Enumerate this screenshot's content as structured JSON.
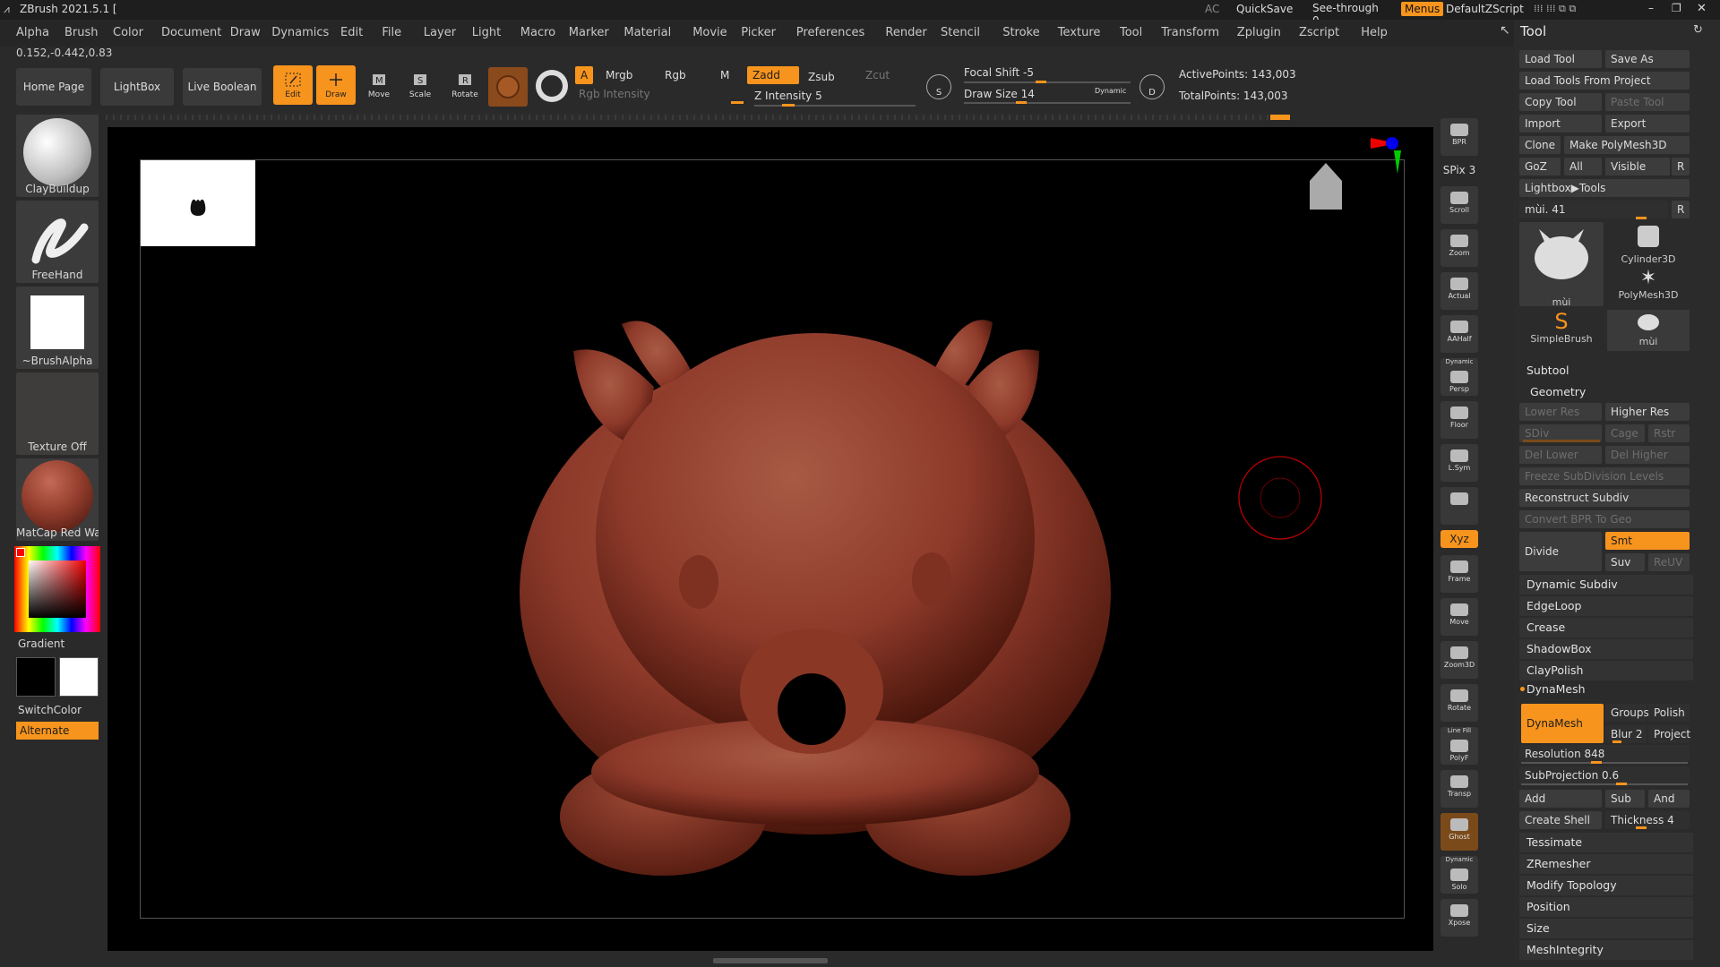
{
  "titlebar": {
    "title": "ZBrush 2021.5.1 [",
    "ac": "AC",
    "quicksave": "QuickSave",
    "seethrough": "See-through",
    "seethrough_value": "0",
    "menus": "Menus",
    "script": "DefaultZScript"
  },
  "menu": [
    "Alpha",
    "Brush",
    "Color",
    "Document",
    "Draw",
    "Dynamics",
    "Edit",
    "File",
    "Layer",
    "Light",
    "Macro",
    "Marker",
    "Material",
    "Movie",
    "Picker",
    "Preferences",
    "Render",
    "Stencil",
    "Stroke",
    "Texture",
    "Tool",
    "Transform",
    "Zplugin",
    "Zscript",
    "Help"
  ],
  "coords": "0.152,-0.442,0.83",
  "toolbar": {
    "home": "Home Page",
    "lightbox": "LightBox",
    "live_boolean": "Live Boolean",
    "edit": "Edit",
    "draw": "Draw",
    "move": "Move",
    "scale": "Scale",
    "rotate": "Rotate",
    "a": "A",
    "mrgb": "Mrgb",
    "rgb": "Rgb",
    "m": "M",
    "zadd": "Zadd",
    "zsub": "Zsub",
    "zcut": "Zcut",
    "rgb_intensity": "Rgb Intensity",
    "z_intensity": "Z Intensity 5",
    "focal_shift": "Focal Shift -5",
    "draw_size": "Draw Size 14",
    "dynamic": "Dynamic",
    "active_points": "ActivePoints: 143,003",
    "total_points": "TotalPoints: 143,003",
    "z_intensity_level": 0.05,
    "focal_level": 0.47,
    "draw_size_level": 0.14
  },
  "left": {
    "brush": "ClayBuildup",
    "stroke": "FreeHand",
    "alpha": "~BrushAlpha",
    "texture": "Texture Off",
    "material": "MatCap Red Wax",
    "gradient": "Gradient",
    "switchcolor": "SwitchColor",
    "alternate": "Alternate"
  },
  "right_shelf": [
    {
      "name": "bpr",
      "label": "BPR"
    },
    {
      "name": "spix",
      "label": "SPix 3"
    },
    {
      "name": "scroll",
      "label": "Scroll"
    },
    {
      "name": "zoom",
      "label": "Zoom"
    },
    {
      "name": "actual",
      "label": "Actual"
    },
    {
      "name": "aahalf",
      "label": "AAHalf"
    },
    {
      "name": "persp",
      "label": "Persp",
      "top": "Dynamic"
    },
    {
      "name": "floor",
      "label": "Floor"
    },
    {
      "name": "lsym",
      "label": "L.Sym"
    },
    {
      "name": "lock",
      "label": ""
    },
    {
      "name": "xyz",
      "label": "Xyz"
    },
    {
      "name": "frame",
      "label": "Frame"
    },
    {
      "name": "move",
      "label": "Move"
    },
    {
      "name": "zoom3d",
      "label": "Zoom3D"
    },
    {
      "name": "rotate",
      "label": "Rotate"
    },
    {
      "name": "polyf",
      "label": "PolyF",
      "top": "Line Fill"
    },
    {
      "name": "transp",
      "label": "Transp"
    },
    {
      "name": "ghost",
      "label": "Ghost"
    },
    {
      "name": "solo",
      "label": "Solo",
      "top": "Dynamic"
    },
    {
      "name": "xpose",
      "label": "Xpose"
    }
  ],
  "tool": {
    "title": "Tool",
    "load_tool": "Load Tool",
    "save_as": "Save As",
    "load_from_project": "Load Tools From Project",
    "copy_tool": "Copy Tool",
    "paste_tool": "Paste Tool",
    "import": "Import",
    "export": "Export",
    "clone": "Clone",
    "make_polymesh": "Make PolyMesh3D",
    "goz": "GoZ",
    "all": "All",
    "visible": "Visible",
    "r": "R",
    "lightbox_tools": "Lightbox▶Tools",
    "current": "mùi. 41",
    "current_level": 0.41,
    "thumbs": [
      "mùi",
      "Cylinder3D",
      "PolyMesh3D",
      "SimpleBrush",
      "mùi"
    ],
    "subtool": "Subtool",
    "geometry": "Geometry",
    "lower_res": "Lower Res",
    "higher_res": "Higher Res",
    "sdiv": "SDiv",
    "cage": "Cage",
    "rstr": "Rstr",
    "del_lower": "Del Lower",
    "del_higher": "Del Higher",
    "freeze": "Freeze SubDivision Levels",
    "reconstruct": "Reconstruct Subdiv",
    "convert_bpr": "Convert BPR To Geo",
    "divide": "Divide",
    "smt": "Smt",
    "suv": "Suv",
    "reuv": "ReUV",
    "sections": [
      "Dynamic Subdiv",
      "EdgeLoop",
      "Crease",
      "ShadowBox",
      "ClayPolish"
    ],
    "dynamesh": "DynaMesh",
    "groups": "Groups",
    "polish": "Polish",
    "blur": "Blur 2",
    "project": "Project",
    "resolution": "Resolution 848",
    "subprojection": "SubProjection 0.6",
    "add": "Add",
    "sub": "Sub",
    "and": "And",
    "create_shell": "Create Shell",
    "thickness": "Thickness 4",
    "resolution_level": 0.21,
    "subprojection_level": 0.6,
    "thickness_level": 0.4,
    "bottom_sections": [
      "Tessimate",
      "ZRemesher",
      "Modify Topology",
      "Position",
      "Size",
      "MeshIntegrity"
    ]
  },
  "colors": {
    "accent": "#f7941d",
    "model": "#8e3a2a"
  }
}
